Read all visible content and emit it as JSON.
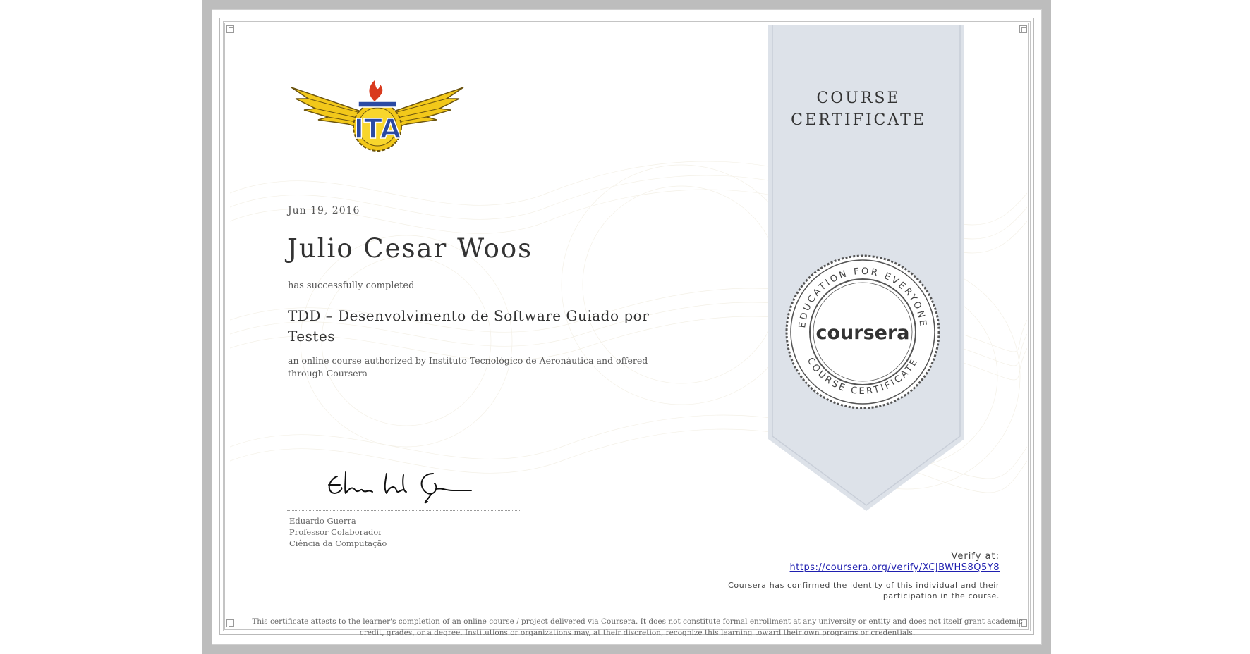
{
  "certificate": {
    "date": "Jun 19, 2016",
    "recipient_name": "Julio Cesar Woos",
    "completed_text": "has successfully completed",
    "course_title": "TDD – Desenvolvimento de Software Guiado por Testes",
    "authorized_text": "an online course authorized by Instituto Tecnológico de Aeronáutica and offered through Coursera",
    "ribbon_line1": "COURSE",
    "ribbon_line2": "CERTIFICATE",
    "logo_text": "ITA",
    "seal": {
      "brand": "coursera",
      "top_arc": "EDUCATION FOR EVERYONE",
      "bottom_arc": "COURSE CERTIFICATE"
    }
  },
  "signatory": {
    "name": "Eduardo Guerra",
    "role": "Professor Colaborador",
    "department": "Ciência da Computação"
  },
  "verify": {
    "label": "Verify at:",
    "url": "https://coursera.org/verify/XCJBWHS8Q5Y8"
  },
  "confirmation_text": "Coursera has confirmed the identity of this individual and their participation in the course.",
  "disclaimer_text": "This certificate attests to the learner's completion of an online course / project delivered via Coursera. It does not constitute formal enrollment at any university or entity and does not itself grant academic credit, grades, or a degree. Institutions or organizations may, at their discretion, recognize this learning toward their own programs or credentials.",
  "colors": {
    "ribbon": "#dde2e9",
    "logo_gold": "#f2c81a",
    "logo_blue": "#2b4aa3",
    "logo_red": "#d93a1e",
    "link": "#1f1fb0"
  }
}
